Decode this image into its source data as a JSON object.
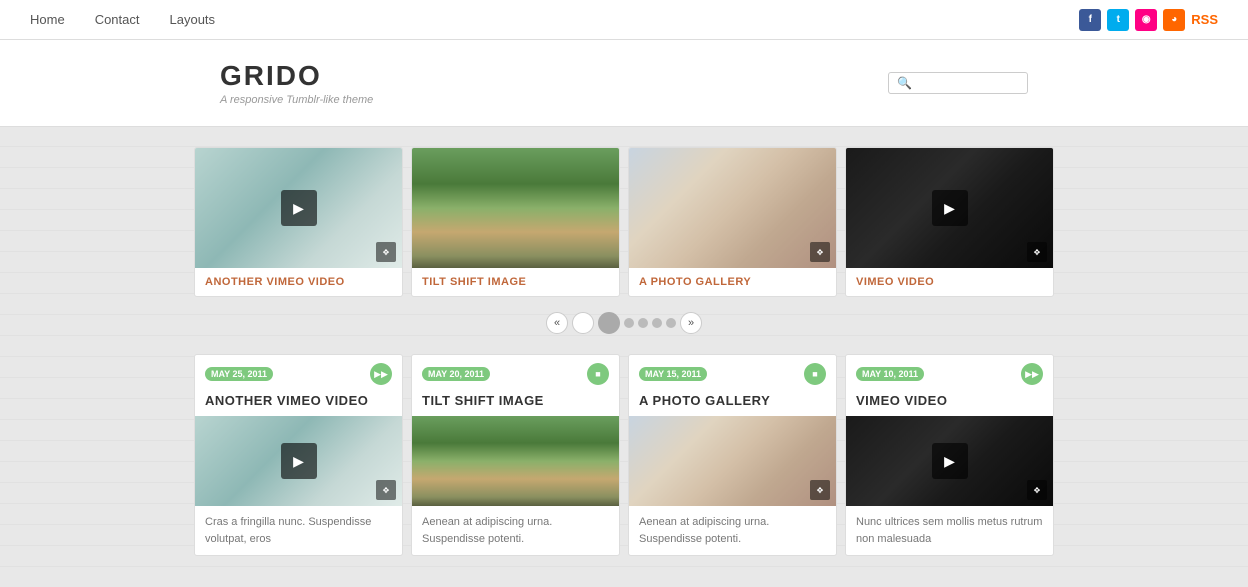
{
  "site": {
    "title": "GRIDO",
    "tagline": "A responsive Tumblr-like theme"
  },
  "nav": {
    "links": [
      {
        "label": "Home",
        "href": "#"
      },
      {
        "label": "Contact",
        "href": "#"
      },
      {
        "label": "Layouts",
        "href": "#"
      }
    ],
    "rss_label": "RSS"
  },
  "search": {
    "placeholder": ""
  },
  "top_cards": [
    {
      "label": "ANOTHER VIMEO VIDEO",
      "thumb_class": "thumb-vimeo1",
      "has_play": true,
      "has_expand": true
    },
    {
      "label": "TILT SHIFT IMAGE",
      "thumb_class": "thumb-tiltshift",
      "has_play": false,
      "has_expand": false
    },
    {
      "label": "A PHOTO GALLERY",
      "thumb_class": "thumb-photogallery",
      "has_play": false,
      "has_expand": true
    },
    {
      "label": "VIMEO VIDEO",
      "thumb_class": "thumb-vimeo2",
      "has_play": true,
      "has_expand": true
    }
  ],
  "pagination": {
    "prev": "«",
    "next": "»",
    "pages": [
      "",
      "",
      "●",
      "●",
      "●",
      "●"
    ]
  },
  "bottom_cards": [
    {
      "date": "MAY 25, 2011",
      "title": "ANOTHER VIMEO VIDEO",
      "thumb_class": "thumb-vimeo1",
      "has_play": true,
      "has_expand": true,
      "desc": "Cras a fringilla nunc. Suspendisse volutpat, eros",
      "type": "video"
    },
    {
      "date": "MAY 20, 2011",
      "title": "TILT SHIFT IMAGE",
      "thumb_class": "thumb-tiltshift",
      "has_play": false,
      "has_expand": false,
      "desc": "Aenean at adipiscing urna. Suspendisse potenti.",
      "type": "image"
    },
    {
      "date": "MAY 15, 2011",
      "title": "A PHOTO GALLERY",
      "thumb_class": "thumb-photogallery",
      "has_play": false,
      "has_expand": true,
      "desc": "Aenean at adipiscing urna. Suspendisse potenti.",
      "type": "gallery"
    },
    {
      "date": "MAY 10, 2011",
      "title": "VIMEO VIDEO",
      "thumb_class": "thumb-vimeo2",
      "has_play": true,
      "has_expand": true,
      "desc": "Nunc ultrices sem mollis metus rutrum non malesuada",
      "type": "video"
    }
  ]
}
